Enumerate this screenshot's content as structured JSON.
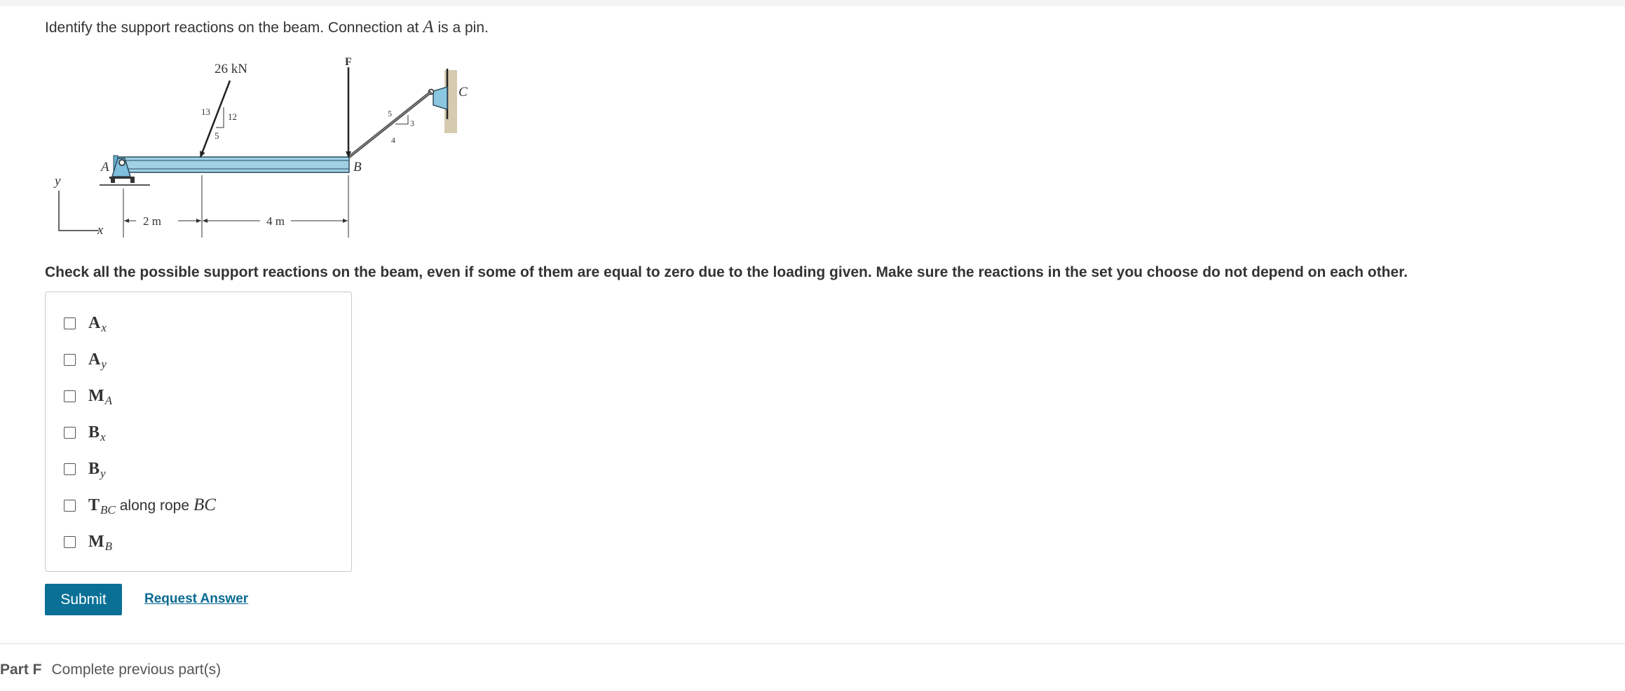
{
  "question": {
    "text_before": "Identify the support reactions on the beam. Connection at ",
    "text_var": "A",
    "text_after": " is a pin."
  },
  "figure": {
    "force_label": "26 kN",
    "force_F_label": "F",
    "slope_hyp": "13",
    "slope_vert": "12",
    "slope_horiz": "5",
    "rope_slope_hyp": "5",
    "rope_slope_vert": "3",
    "rope_slope_horiz": "4",
    "point_A": "A",
    "point_B": "B",
    "point_C": "C",
    "axis_y": "y",
    "axis_x": "x",
    "dim_1": "2 m",
    "dim_2": "4 m",
    "colors": {
      "beam": "#9fd0e6",
      "beam_edge": "#2a4a5c",
      "support": "#7fbfdc",
      "wall": "#c8b896"
    }
  },
  "instruction": "Check all the possible support reactions on the beam, even if some of them are equal to zero due to the loading given. Make sure the reactions in the set you choose do not depend on each other.",
  "options": [
    {
      "main": "A",
      "sub": "x",
      "suffix": "",
      "suffix_var": "",
      "checked": false
    },
    {
      "main": "A",
      "sub": "y",
      "suffix": "",
      "suffix_var": "",
      "checked": false
    },
    {
      "main": "M",
      "sub": "A",
      "suffix": "",
      "suffix_var": "",
      "checked": false
    },
    {
      "main": "B",
      "sub": "x",
      "suffix": "",
      "suffix_var": "",
      "checked": false
    },
    {
      "main": "B",
      "sub": "y",
      "suffix": "",
      "suffix_var": "",
      "checked": false
    },
    {
      "main": "T",
      "sub": "BC",
      "suffix": "along rope",
      "suffix_var": "BC",
      "checked": false
    },
    {
      "main": "M",
      "sub": "B",
      "suffix": "",
      "suffix_var": "",
      "checked": false
    }
  ],
  "buttons": {
    "submit_label": "Submit",
    "request_answer_label": "Request Answer"
  },
  "part_f": {
    "label": "Part F",
    "status": "Complete previous part(s)"
  },
  "colors": {
    "accent": "#0a7096",
    "link": "#0a6a93"
  }
}
